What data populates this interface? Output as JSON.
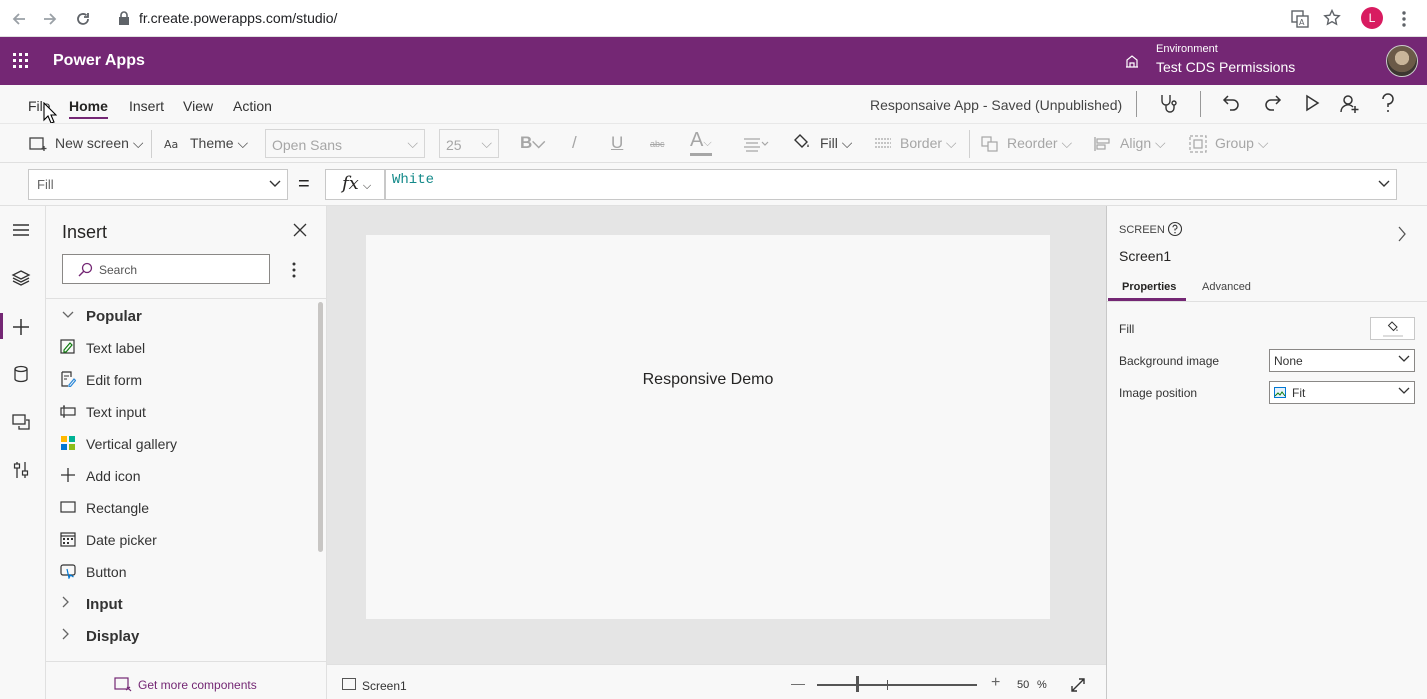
{
  "browser": {
    "url": "fr.create.powerapps.com/studio/",
    "profile_initial": "L"
  },
  "appbar": {
    "title": "Power Apps",
    "environment_label": "Environment",
    "environment_name": "Test CDS Permissions"
  },
  "menu": {
    "items": [
      "File",
      "Home",
      "Insert",
      "View",
      "Action"
    ],
    "active": "Home",
    "app_status": "Responsaive App - Saved (Unpublished)"
  },
  "ribbon": {
    "new_screen": "New screen",
    "theme": "Theme",
    "font": "Open Sans",
    "font_size": "25",
    "bold": "B",
    "italic": "/",
    "underline": "U",
    "strike": "abc",
    "font_color": "A",
    "fill": "Fill",
    "border": "Border",
    "reorder": "Reorder",
    "align": "Align",
    "group": "Group"
  },
  "formula": {
    "property": "Fill",
    "equals": "=",
    "fx": "fx",
    "value": "White"
  },
  "insert_panel": {
    "title": "Insert",
    "search_placeholder": "Search",
    "categories": {
      "popular": "Popular",
      "input": "Input",
      "display": "Display"
    },
    "items": [
      {
        "label": "Text label",
        "icon": "text-label-icon"
      },
      {
        "label": "Edit form",
        "icon": "edit-form-icon"
      },
      {
        "label": "Text input",
        "icon": "text-input-icon"
      },
      {
        "label": "Vertical gallery",
        "icon": "gallery-icon"
      },
      {
        "label": "Add icon",
        "icon": "plus-icon"
      },
      {
        "label": "Rectangle",
        "icon": "rectangle-icon"
      },
      {
        "label": "Date picker",
        "icon": "calendar-icon"
      },
      {
        "label": "Button",
        "icon": "button-icon"
      }
    ],
    "get_more": "Get more components"
  },
  "canvas": {
    "screen_text": "Responsive Demo",
    "screen_tab": "Screen1",
    "zoom": "50",
    "zoom_unit": "%"
  },
  "right_panel": {
    "kind": "SCREEN",
    "name": "Screen1",
    "tabs": [
      "Properties",
      "Advanced"
    ],
    "properties": {
      "fill_label": "Fill",
      "background_image_label": "Background image",
      "background_image_value": "None",
      "image_position_label": "Image position",
      "image_position_value": "Fit"
    }
  },
  "colors": {
    "brand": "#742774",
    "formula_text": "#148a8a",
    "canvas_bg": "#e5e5e5"
  }
}
